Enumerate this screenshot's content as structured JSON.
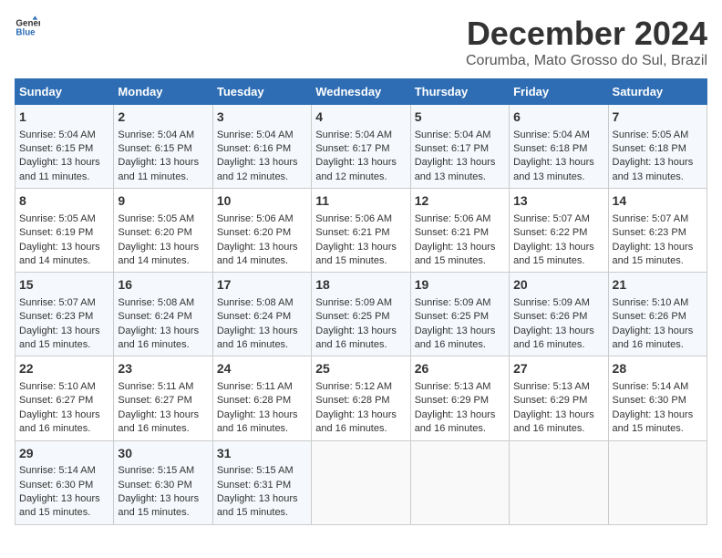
{
  "logo": {
    "line1": "General",
    "line2": "Blue"
  },
  "title": "December 2024",
  "location": "Corumba, Mato Grosso do Sul, Brazil",
  "days_of_week": [
    "Sunday",
    "Monday",
    "Tuesday",
    "Wednesday",
    "Thursday",
    "Friday",
    "Saturday"
  ],
  "weeks": [
    [
      {
        "day": "1",
        "sunrise": "5:04 AM",
        "sunset": "6:15 PM",
        "daylight": "13 hours and 11 minutes."
      },
      {
        "day": "2",
        "sunrise": "5:04 AM",
        "sunset": "6:15 PM",
        "daylight": "13 hours and 11 minutes."
      },
      {
        "day": "3",
        "sunrise": "5:04 AM",
        "sunset": "6:16 PM",
        "daylight": "13 hours and 12 minutes."
      },
      {
        "day": "4",
        "sunrise": "5:04 AM",
        "sunset": "6:17 PM",
        "daylight": "13 hours and 12 minutes."
      },
      {
        "day": "5",
        "sunrise": "5:04 AM",
        "sunset": "6:17 PM",
        "daylight": "13 hours and 13 minutes."
      },
      {
        "day": "6",
        "sunrise": "5:04 AM",
        "sunset": "6:18 PM",
        "daylight": "13 hours and 13 minutes."
      },
      {
        "day": "7",
        "sunrise": "5:05 AM",
        "sunset": "6:18 PM",
        "daylight": "13 hours and 13 minutes."
      }
    ],
    [
      {
        "day": "8",
        "sunrise": "5:05 AM",
        "sunset": "6:19 PM",
        "daylight": "13 hours and 14 minutes."
      },
      {
        "day": "9",
        "sunrise": "5:05 AM",
        "sunset": "6:20 PM",
        "daylight": "13 hours and 14 minutes."
      },
      {
        "day": "10",
        "sunrise": "5:06 AM",
        "sunset": "6:20 PM",
        "daylight": "13 hours and 14 minutes."
      },
      {
        "day": "11",
        "sunrise": "5:06 AM",
        "sunset": "6:21 PM",
        "daylight": "13 hours and 15 minutes."
      },
      {
        "day": "12",
        "sunrise": "5:06 AM",
        "sunset": "6:21 PM",
        "daylight": "13 hours and 15 minutes."
      },
      {
        "day": "13",
        "sunrise": "5:07 AM",
        "sunset": "6:22 PM",
        "daylight": "13 hours and 15 minutes."
      },
      {
        "day": "14",
        "sunrise": "5:07 AM",
        "sunset": "6:23 PM",
        "daylight": "13 hours and 15 minutes."
      }
    ],
    [
      {
        "day": "15",
        "sunrise": "5:07 AM",
        "sunset": "6:23 PM",
        "daylight": "13 hours and 15 minutes."
      },
      {
        "day": "16",
        "sunrise": "5:08 AM",
        "sunset": "6:24 PM",
        "daylight": "13 hours and 16 minutes."
      },
      {
        "day": "17",
        "sunrise": "5:08 AM",
        "sunset": "6:24 PM",
        "daylight": "13 hours and 16 minutes."
      },
      {
        "day": "18",
        "sunrise": "5:09 AM",
        "sunset": "6:25 PM",
        "daylight": "13 hours and 16 minutes."
      },
      {
        "day": "19",
        "sunrise": "5:09 AM",
        "sunset": "6:25 PM",
        "daylight": "13 hours and 16 minutes."
      },
      {
        "day": "20",
        "sunrise": "5:09 AM",
        "sunset": "6:26 PM",
        "daylight": "13 hours and 16 minutes."
      },
      {
        "day": "21",
        "sunrise": "5:10 AM",
        "sunset": "6:26 PM",
        "daylight": "13 hours and 16 minutes."
      }
    ],
    [
      {
        "day": "22",
        "sunrise": "5:10 AM",
        "sunset": "6:27 PM",
        "daylight": "13 hours and 16 minutes."
      },
      {
        "day": "23",
        "sunrise": "5:11 AM",
        "sunset": "6:27 PM",
        "daylight": "13 hours and 16 minutes."
      },
      {
        "day": "24",
        "sunrise": "5:11 AM",
        "sunset": "6:28 PM",
        "daylight": "13 hours and 16 minutes."
      },
      {
        "day": "25",
        "sunrise": "5:12 AM",
        "sunset": "6:28 PM",
        "daylight": "13 hours and 16 minutes."
      },
      {
        "day": "26",
        "sunrise": "5:13 AM",
        "sunset": "6:29 PM",
        "daylight": "13 hours and 16 minutes."
      },
      {
        "day": "27",
        "sunrise": "5:13 AM",
        "sunset": "6:29 PM",
        "daylight": "13 hours and 16 minutes."
      },
      {
        "day": "28",
        "sunrise": "5:14 AM",
        "sunset": "6:30 PM",
        "daylight": "13 hours and 15 minutes."
      }
    ],
    [
      {
        "day": "29",
        "sunrise": "5:14 AM",
        "sunset": "6:30 PM",
        "daylight": "13 hours and 15 minutes."
      },
      {
        "day": "30",
        "sunrise": "5:15 AM",
        "sunset": "6:30 PM",
        "daylight": "13 hours and 15 minutes."
      },
      {
        "day": "31",
        "sunrise": "5:15 AM",
        "sunset": "6:31 PM",
        "daylight": "13 hours and 15 minutes."
      },
      null,
      null,
      null,
      null
    ]
  ],
  "labels": {
    "sunrise": "Sunrise:",
    "sunset": "Sunset:",
    "daylight": "Daylight:"
  },
  "colors": {
    "header_bg": "#2e6db4",
    "header_text": "#ffffff",
    "odd_row": "#f5f8fc",
    "even_row": "#ffffff"
  }
}
